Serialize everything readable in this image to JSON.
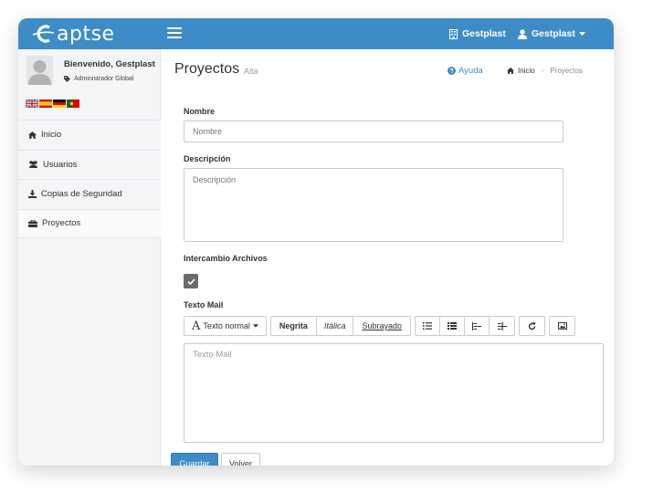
{
  "brand": {
    "name": "aptse",
    "accent": "#3e8cc7"
  },
  "topbar": {
    "company_link": "Gestplast",
    "user_menu": "Gestplast"
  },
  "sidebar": {
    "welcome": "Bienvenido, Gestplast",
    "role": "Administrador Global",
    "languages": [
      "English",
      "Español",
      "Deutsch",
      "Português"
    ],
    "items": [
      {
        "label": "Inicio",
        "icon": "home-icon"
      },
      {
        "label": "Usuarios",
        "icon": "users-icon"
      },
      {
        "label": "Copias de Seguridad",
        "icon": "download-icon"
      },
      {
        "label": "Proyectos",
        "icon": "briefcase-icon"
      }
    ]
  },
  "page": {
    "title": "Proyectos",
    "subtitle": "Alta",
    "help": "Ayuda",
    "breadcrumb": [
      "Inicio",
      "Proyectos"
    ]
  },
  "form": {
    "name_label": "Nombre",
    "name_placeholder": "Nombre",
    "description_label": "Descripción",
    "description_placeholder": "Descripción",
    "exchange_label": "Intercambio Archivos",
    "exchange_checked": true,
    "mail_label": "Texto Mail",
    "mail_placeholder": "Texto Mail",
    "toolbar": {
      "font_size": "Texto normal",
      "bold": "Negrita",
      "italic": "Itálica",
      "underline": "Subrayado"
    },
    "save_button": "Guardar",
    "back_button": "Volver"
  }
}
